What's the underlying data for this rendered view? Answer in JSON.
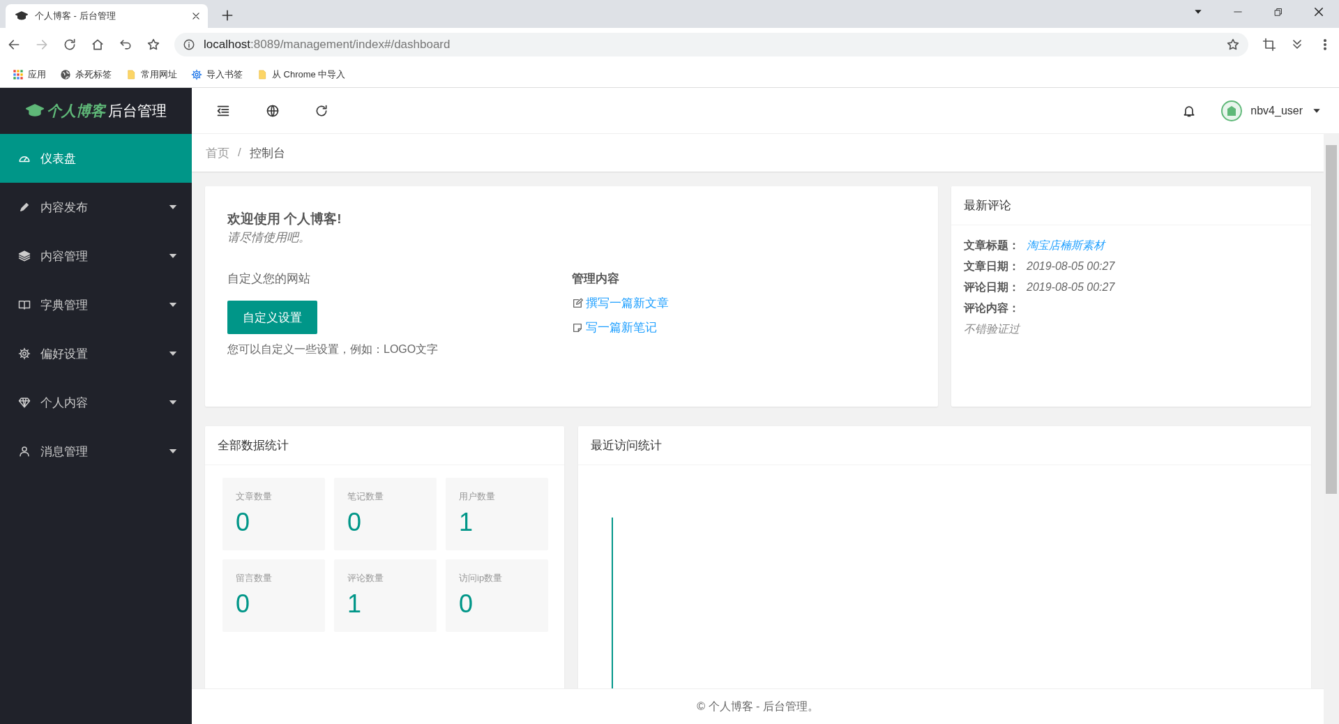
{
  "browser": {
    "tab_title": "个人博客 - 后台管理",
    "url_host": "localhost",
    "url_path": ":8089/management/index#/dashboard",
    "forward_disabled": true,
    "bookmarks": [
      {
        "label": "应用",
        "kind": "apps"
      },
      {
        "label": "杀死标签",
        "kind": "globe"
      },
      {
        "label": "常用网址",
        "kind": "folder"
      },
      {
        "label": "导入书签",
        "kind": "gear"
      },
      {
        "label": "从 Chrome 中导入",
        "kind": "folder"
      }
    ]
  },
  "logo": {
    "brand": "个人博客",
    "suffix": "后台管理"
  },
  "sidebar": {
    "items": [
      {
        "label": "仪表盘",
        "kind": "gauge",
        "selected": true,
        "has_submenu": false
      },
      {
        "label": "内容发布",
        "kind": "pen",
        "selected": false,
        "has_submenu": true
      },
      {
        "label": "内容管理",
        "kind": "layers",
        "selected": false,
        "has_submenu": true
      },
      {
        "label": "字典管理",
        "kind": "book",
        "selected": false,
        "has_submenu": true
      },
      {
        "label": "偏好设置",
        "kind": "gear",
        "selected": false,
        "has_submenu": true
      },
      {
        "label": "个人内容",
        "kind": "diamond",
        "selected": false,
        "has_submenu": true
      },
      {
        "label": "消息管理",
        "kind": "user",
        "selected": false,
        "has_submenu": true
      }
    ]
  },
  "header": {
    "user": "nbv4_user"
  },
  "breadcrumb": {
    "separator": "/",
    "items": [
      {
        "label": "首页"
      },
      {
        "label": "控制台"
      }
    ]
  },
  "welcome": {
    "title": "欢迎使用 个人博客!",
    "subtitle": "请尽情使用吧。",
    "customize_heading": "自定义您的网站",
    "customize_button": "自定义设置",
    "customize_hint": "您可以自定义一些设置，例如：LOGO文字",
    "manage_heading": "管理内容",
    "links": [
      {
        "label": "撰写一篇新文章",
        "kind": "edit"
      },
      {
        "label": "写一篇新笔记",
        "kind": "note"
      }
    ]
  },
  "latest_comment": {
    "title": "最新评论",
    "fields": [
      {
        "label": "文章标题：",
        "value": "淘宝店楠斯素材",
        "kind": "link"
      },
      {
        "label": "文章日期：",
        "value": "2019-08-05 00:27",
        "kind": "text"
      },
      {
        "label": "评论日期：",
        "value": "2019-08-05 00:27",
        "kind": "text"
      },
      {
        "label": "评论内容：",
        "value": "不错验证过",
        "kind": "block"
      }
    ]
  },
  "stats": {
    "title": "全部数据统计",
    "tiles": [
      {
        "label": "文章数量",
        "value": "0"
      },
      {
        "label": "笔记数量",
        "value": "0"
      },
      {
        "label": "用户数量",
        "value": "1"
      },
      {
        "label": "留言数量",
        "value": "0"
      },
      {
        "label": "评论数量",
        "value": "1"
      },
      {
        "label": "访问ip数量",
        "value": "0"
      }
    ]
  },
  "visits": {
    "title": "最近访问统计"
  },
  "footer": "© 个人博客 - 后台管理。"
}
